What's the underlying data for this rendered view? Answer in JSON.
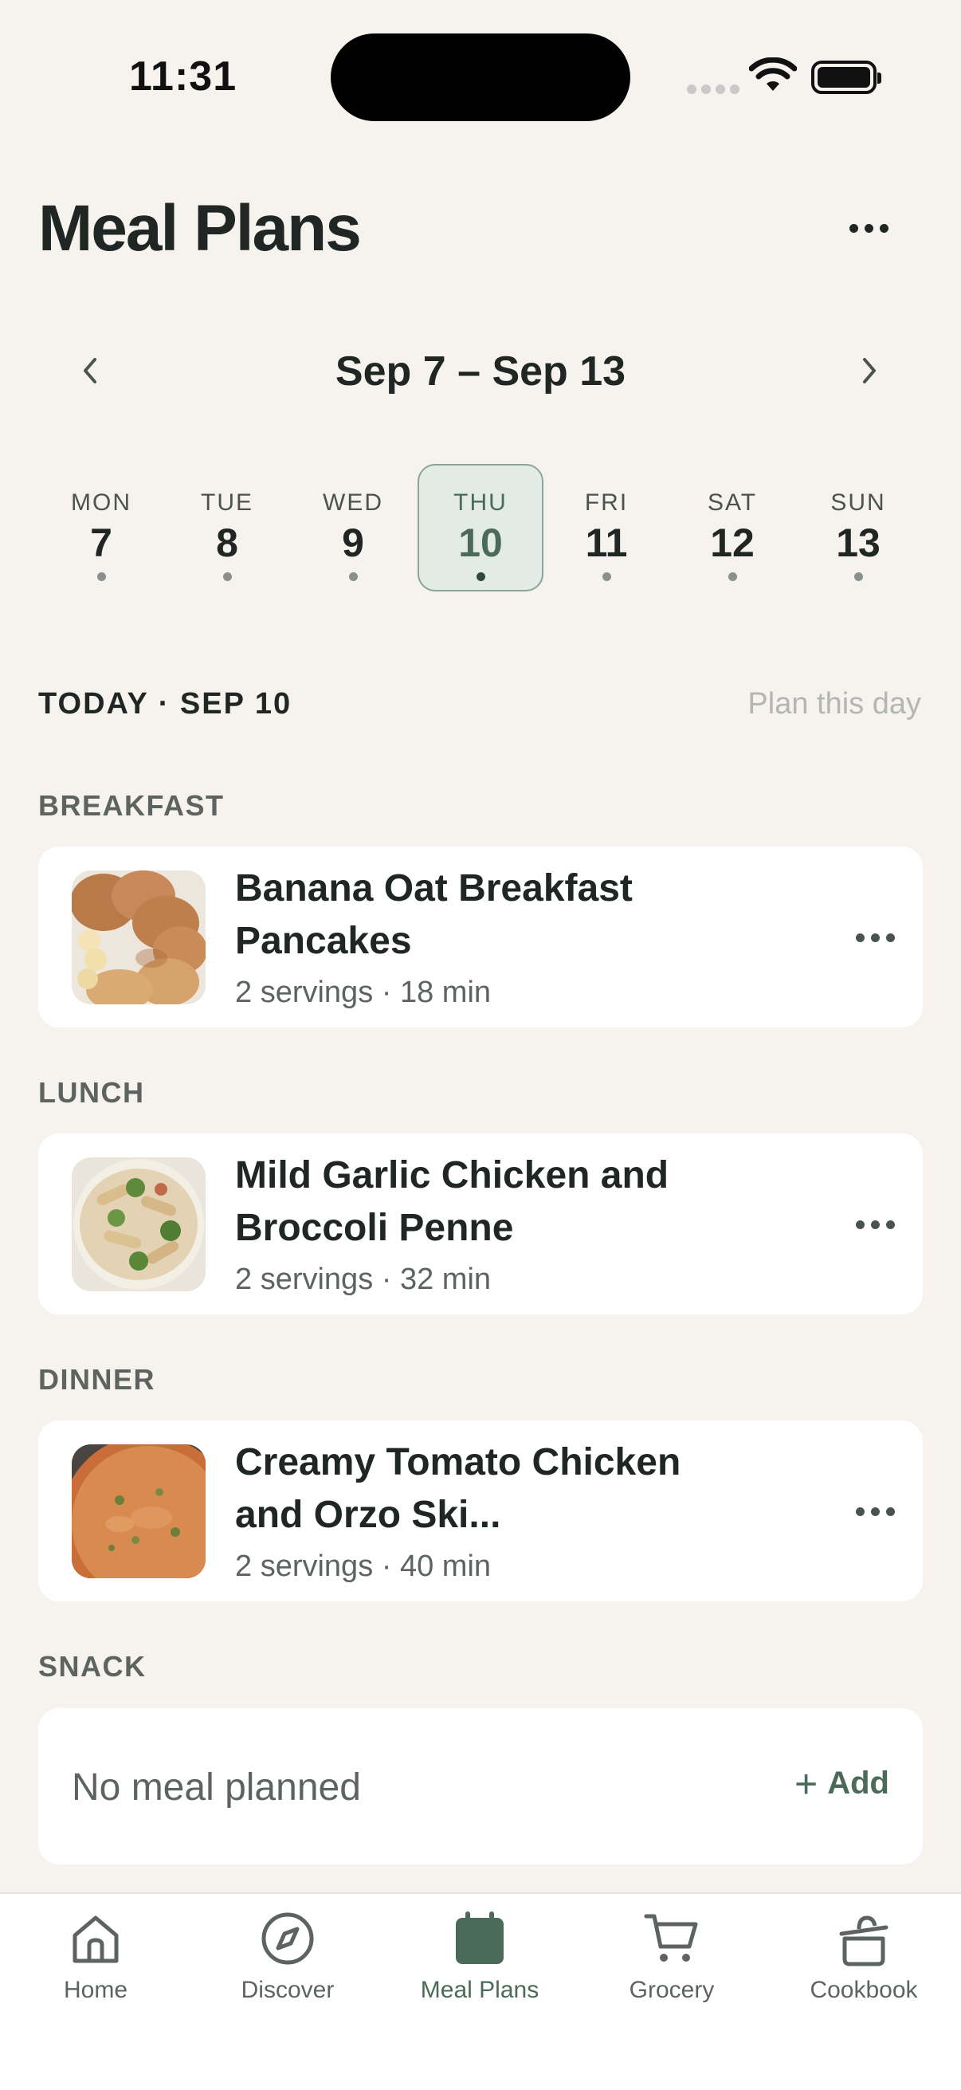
{
  "status_bar": {
    "time": "11:31"
  },
  "header": {
    "title": "Meal Plans"
  },
  "week": {
    "range": "Sep 7 – Sep 13",
    "days": [
      {
        "name": "MON",
        "num": "7"
      },
      {
        "name": "TUE",
        "num": "8"
      },
      {
        "name": "WED",
        "num": "9"
      },
      {
        "name": "THU",
        "num": "10",
        "selected": true
      },
      {
        "name": "FRI",
        "num": "11"
      },
      {
        "name": "SAT",
        "num": "12"
      },
      {
        "name": "SUN",
        "num": "13"
      }
    ]
  },
  "today": {
    "label": "TODAY · SEP 10",
    "plan_action": "Plan this day"
  },
  "sections": {
    "breakfast": {
      "label": "BREAKFAST",
      "title": "Banana Oat Breakfast Pancakes",
      "meta": "2 servings · 18 min"
    },
    "lunch": {
      "label": "LUNCH",
      "title": "Mild Garlic Chicken and Broccoli Penne",
      "meta": "2 servings · 32 min"
    },
    "dinner": {
      "label": "DINNER",
      "title": "Creamy Tomato Chicken and Orzo Ski...",
      "meta": "2 servings · 40 min"
    },
    "snack": {
      "label": "SNACK",
      "empty_text": "No meal planned",
      "add_label": "Add"
    }
  },
  "tabs": [
    {
      "label": "Home",
      "icon": "home-icon"
    },
    {
      "label": "Discover",
      "icon": "compass-icon"
    },
    {
      "label": "Meal Plans",
      "icon": "calendar-icon",
      "active": true
    },
    {
      "label": "Grocery",
      "icon": "cart-icon"
    },
    {
      "label": "Cookbook",
      "icon": "pot-icon"
    }
  ],
  "colors": {
    "background": "#f6f3ee",
    "accent": "#4c6a5a",
    "selected_day_bg": "#e2ebe5",
    "text": "#1f2623",
    "muted": "#5d6360"
  }
}
